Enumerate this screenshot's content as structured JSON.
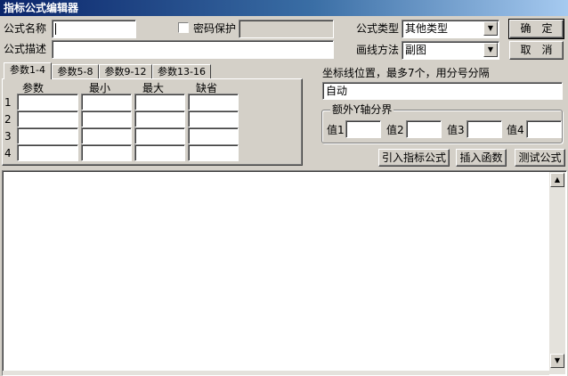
{
  "window": {
    "title": "指标公式编辑器"
  },
  "form": {
    "name_label": "公式名称",
    "name_value": "",
    "password_label": "密码保护",
    "password_value": "",
    "desc_label": "公式描述",
    "desc_value": "",
    "type_label": "公式类型",
    "type_value": "其他类型",
    "draw_label": "画线方法",
    "draw_value": "副图"
  },
  "buttons": {
    "ok": "确　定",
    "cancel": "取　消",
    "import": "引入指标公式",
    "insert_func": "插入函数",
    "test": "测试公式"
  },
  "tabs": [
    "参数1-4",
    "参数5-8",
    "参数9-12",
    "参数13-16"
  ],
  "params": {
    "headers": [
      "参数",
      "最小",
      "最大",
      "缺省"
    ],
    "rows": [
      "1",
      "2",
      "3",
      "4"
    ]
  },
  "axis": {
    "label": "坐标线位置，最多7个，用分号分隔",
    "value": "自动"
  },
  "y_bounds": {
    "group_label": "额外Y轴分界",
    "fields": [
      "值1",
      "值2",
      "值3",
      "值4"
    ]
  },
  "editor": {
    "content": ""
  }
}
